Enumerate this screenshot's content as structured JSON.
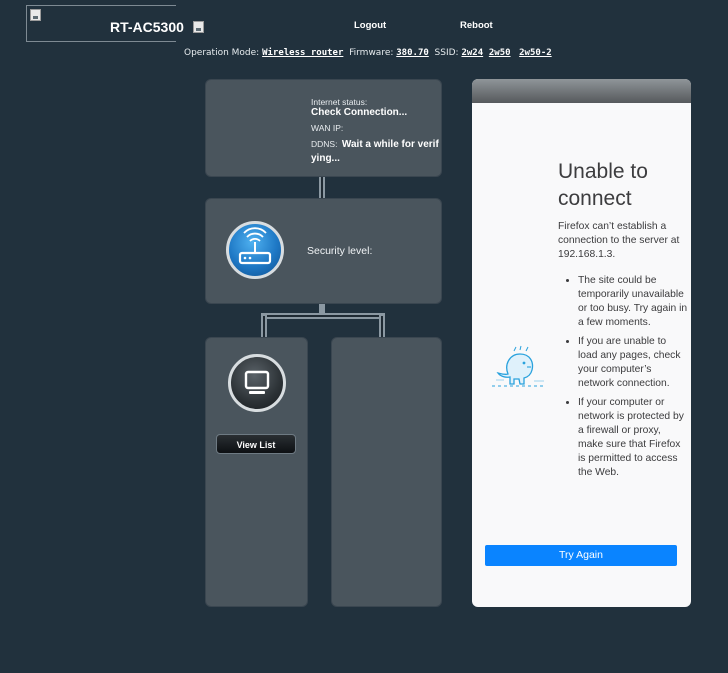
{
  "header": {
    "model": "RT-AC5300",
    "logout_label": "Logout",
    "reboot_label": "Reboot"
  },
  "opbar": {
    "mode_label": "Operation Mode:",
    "mode_value": "Wireless router",
    "firmware_label": "Firmware:",
    "firmware_value": "380.70",
    "ssid_label": "SSID:",
    "ssids": [
      "2w24",
      "2w50",
      "2w50-2"
    ]
  },
  "internet": {
    "status_label": "Internet status:",
    "status_value": "Check Connection...",
    "wan_ip_label": "WAN IP:",
    "ddns_label": "DDNS:",
    "ddns_value_line1": "Wait a while for verif",
    "ddns_value_line2": "ying..."
  },
  "router": {
    "security_label": "Security level:"
  },
  "clients": {
    "view_list_label": "View List"
  },
  "firefox": {
    "title_line1": "Unable to",
    "title_line2": "connect",
    "description": "Firefox can’t establish a connection to the server at 192.168.1.3.",
    "bullets": [
      "The site could be temporarily unavailable or too busy. Try again in a few moments.",
      "If you are unable to load any pages, check your computer’s network connection.",
      "If your computer or network is protected by a firewall or proxy, make sure that Firefox is permitted to access the Web."
    ],
    "try_again_label": "Try Again"
  },
  "colors": {
    "background": "#21313d",
    "panel": "#4a555d",
    "router_blue": "#1e78c5",
    "try_again_blue": "#0a84ff"
  },
  "icons": [
    "broken-image-icon",
    "router-icon",
    "monitor-icon",
    "dinosaur-illustration"
  ]
}
